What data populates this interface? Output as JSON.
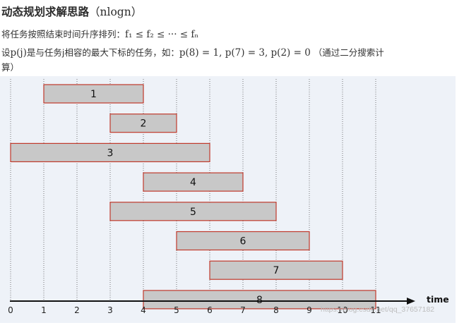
{
  "heading": {
    "main": "动态规划求解思路",
    "paren": "（nlogn）"
  },
  "text": {
    "line1_prefix": "将任务按照结束时间升序排列：",
    "line1_math": "f₁ ≤ f₂ ≤ ··· ≤ fₙ",
    "line2_prefix": "设",
    "line2_math1": "p(j)",
    "line2_mid": "是与任务j相容的最大下标的任务，如：",
    "line2_math2": "p(8) = 1, p(7) = 3, p(2) = 0",
    "line2_suffix": " （通过二分搜索计",
    "line3": "算）"
  },
  "chart_data": {
    "type": "gantt",
    "x_ticks": [
      0,
      1,
      2,
      3,
      4,
      5,
      6,
      7,
      8,
      9,
      10,
      11
    ],
    "x_label": "time",
    "jobs": [
      {
        "label": "1",
        "start": 1,
        "end": 4
      },
      {
        "label": "2",
        "start": 3,
        "end": 5
      },
      {
        "label": "3",
        "start": 0,
        "end": 6
      },
      {
        "label": "4",
        "start": 4,
        "end": 7
      },
      {
        "label": "5",
        "start": 3,
        "end": 8
      },
      {
        "label": "6",
        "start": 5,
        "end": 9
      },
      {
        "label": "7",
        "start": 6,
        "end": 10
      },
      {
        "label": "8",
        "start": 4,
        "end": 11
      }
    ],
    "grid": true,
    "bar_fill": "#c8c8c8",
    "bar_stroke": "#c0392b"
  },
  "watermark": "https://blog.csdn.net/qq_37657182"
}
